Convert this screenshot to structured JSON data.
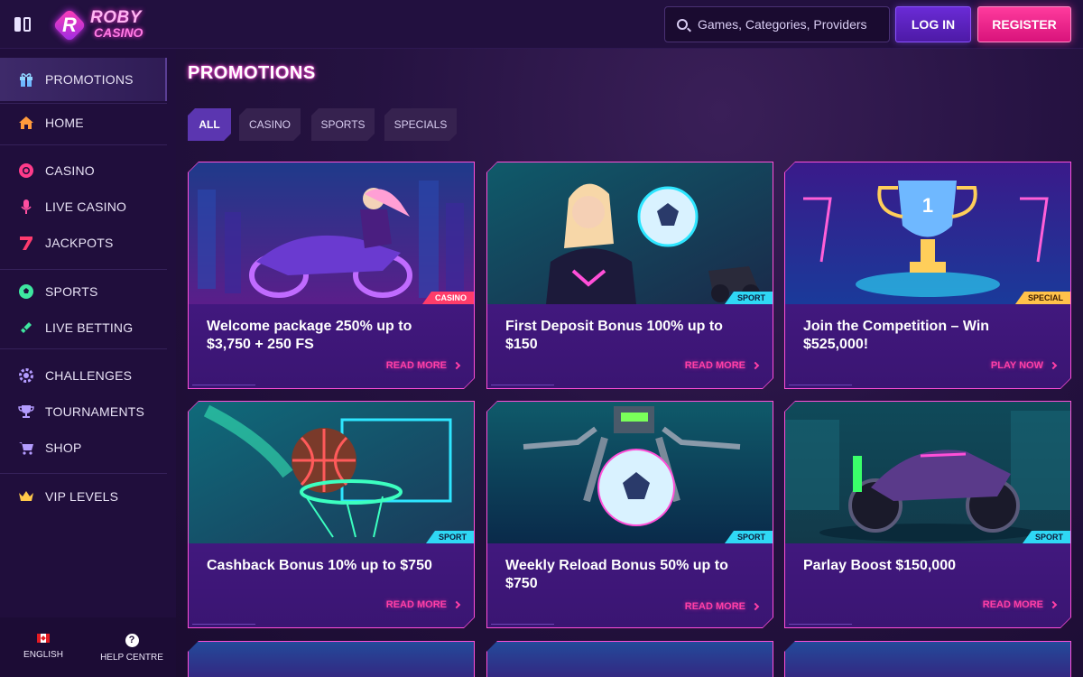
{
  "brand": {
    "line1": "ROBY",
    "line2": "CASINO",
    "badge_letter": "R"
  },
  "header": {
    "search_placeholder": "Games, Categories, Providers",
    "login_label": "LOG IN",
    "register_label": "REGISTER"
  },
  "sidebar": {
    "items": [
      {
        "label": "PROMOTIONS",
        "icon": "gift-icon",
        "color": "#8fd3ff"
      },
      {
        "label": "HOME",
        "icon": "home-icon",
        "color": "#ff9a3c"
      },
      {
        "label": "CASINO",
        "icon": "casino-chip-icon",
        "color": "#ff3b8a"
      },
      {
        "label": "LIVE CASINO",
        "icon": "microphone-icon",
        "color": "#ff4fa0"
      },
      {
        "label": "JACKPOTS",
        "icon": "seven-icon",
        "color": "#ff3b6e"
      },
      {
        "label": "SPORTS",
        "icon": "soccer-ball-icon",
        "color": "#3ee6a0"
      },
      {
        "label": "LIVE BETTING",
        "icon": "ticket-icon",
        "color": "#3ee6a0"
      },
      {
        "label": "CHALLENGES",
        "icon": "gear-icon",
        "color": "#b49cff"
      },
      {
        "label": "TOURNAMENTS",
        "icon": "trophy-icon",
        "color": "#b49cff"
      },
      {
        "label": "SHOP",
        "icon": "cart-icon",
        "color": "#b49cff"
      },
      {
        "label": "VIP LEVELS",
        "icon": "crown-icon",
        "color": "#ffc94a"
      }
    ],
    "footer": {
      "language": "ENGLISH",
      "help": "HELP CENTRE"
    }
  },
  "main": {
    "title": "PROMOTIONS",
    "tabs": [
      "ALL",
      "CASINO",
      "SPORTS",
      "SPECIALS"
    ],
    "cards": [
      {
        "title": "Welcome package 250% up to $3,750 + 250 FS",
        "tag": "CASINO",
        "cta": "READ MORE"
      },
      {
        "title": "First Deposit Bonus 100% up to $150",
        "tag": "SPORT",
        "cta": "READ MORE"
      },
      {
        "title": "Join the Competition – Win $525,000!",
        "tag": "SPECIAL",
        "cta": "PLAY NOW"
      },
      {
        "title": "Cashback Bonus 10% up to $750",
        "tag": "SPORT",
        "cta": "READ MORE"
      },
      {
        "title": "Weekly Reload Bonus 50% up to $750",
        "tag": "SPORT",
        "cta": "READ MORE"
      },
      {
        "title": "Parlay Boost $150,000",
        "tag": "SPORT",
        "cta": "READ MORE"
      }
    ]
  }
}
